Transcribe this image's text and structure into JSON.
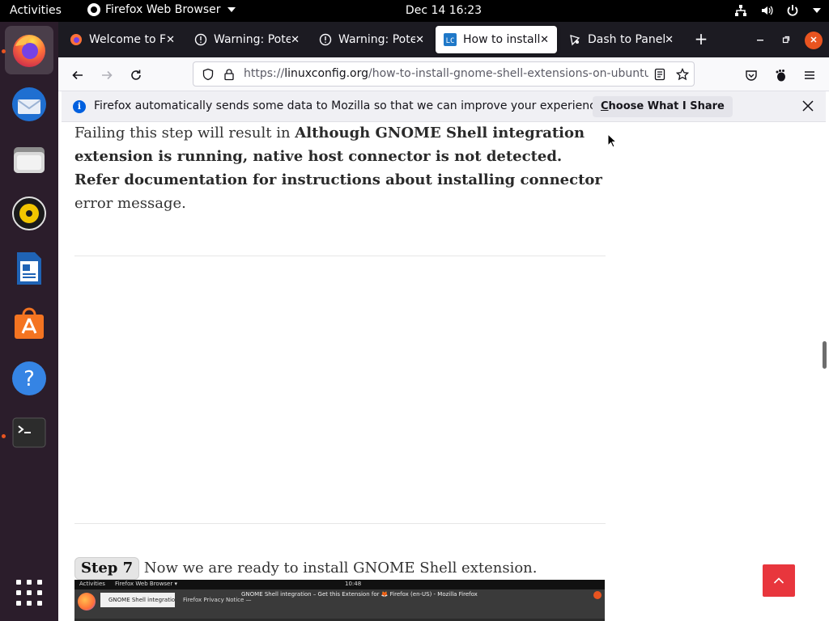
{
  "topbar": {
    "activities": "Activities",
    "app_name": "Firefox Web Browser",
    "clock": "Dec 14  16:23"
  },
  "dock": {
    "items": [
      {
        "name": "Firefox",
        "icon": "firefox-icon"
      },
      {
        "name": "Thunderbird",
        "icon": "thunderbird-icon"
      },
      {
        "name": "Files",
        "icon": "files-icon"
      },
      {
        "name": "Rhythmbox",
        "icon": "rhythmbox-icon"
      },
      {
        "name": "LibreOffice Writer",
        "icon": "writer-icon"
      },
      {
        "name": "Ubuntu Software",
        "icon": "software-icon"
      },
      {
        "name": "Help",
        "icon": "help-icon"
      },
      {
        "name": "Terminal",
        "icon": "terminal-icon"
      },
      {
        "name": "Show Applications",
        "icon": "app-grid-icon"
      }
    ]
  },
  "browser": {
    "tabs": [
      {
        "title": "Welcome to Fi",
        "icon": "firefox-icon"
      },
      {
        "title": "Warning: Poter",
        "icon": "warning-icon"
      },
      {
        "title": "Warning: Pote",
        "icon": "warning-icon"
      },
      {
        "title": "How to install",
        "icon": "linuxconfig-icon",
        "selected": true
      },
      {
        "title": "Dash to Panel",
        "icon": "gnome-icon"
      }
    ],
    "url_prefix": "https://",
    "url_domain": "linuxconfig.org",
    "url_path": "/how-to-install-gnome-shell-extensions-on-ubuntu",
    "notice_text": "Firefox automatically sends some data to Mozilla so that we can improve your experience.",
    "notice_button": "Choose What I Share",
    "notice_button_accesskey": "C"
  },
  "article": {
    "failing_pre": "Failing this step will result in ",
    "failing_bold": "Although GNOME Shell integration extension is running, native host connector is not detected. Refer documentation for instructions about installing connector",
    "failing_post": " error message.",
    "step_badge": "Step 7",
    "step_text": " Now we are ready to install GNOME Shell extension."
  },
  "screenshot_thumb": {
    "activities": "Activities",
    "app": "Firefox Web Browser ▾",
    "time": "10:48",
    "window_title": "GNOME Shell integration – Get this Extension for 🦊 Firefox (en-US) - Mozilla Firefox",
    "tab1": "GNOME Shell integratio",
    "tab2": "Firefox Privacy Notice —"
  },
  "colors": {
    "ubuntu_orange": "#e95420",
    "dock_bg": "#2b1d2b",
    "scroll_top_red": "#e8363d",
    "info_blue": "#0060df"
  }
}
